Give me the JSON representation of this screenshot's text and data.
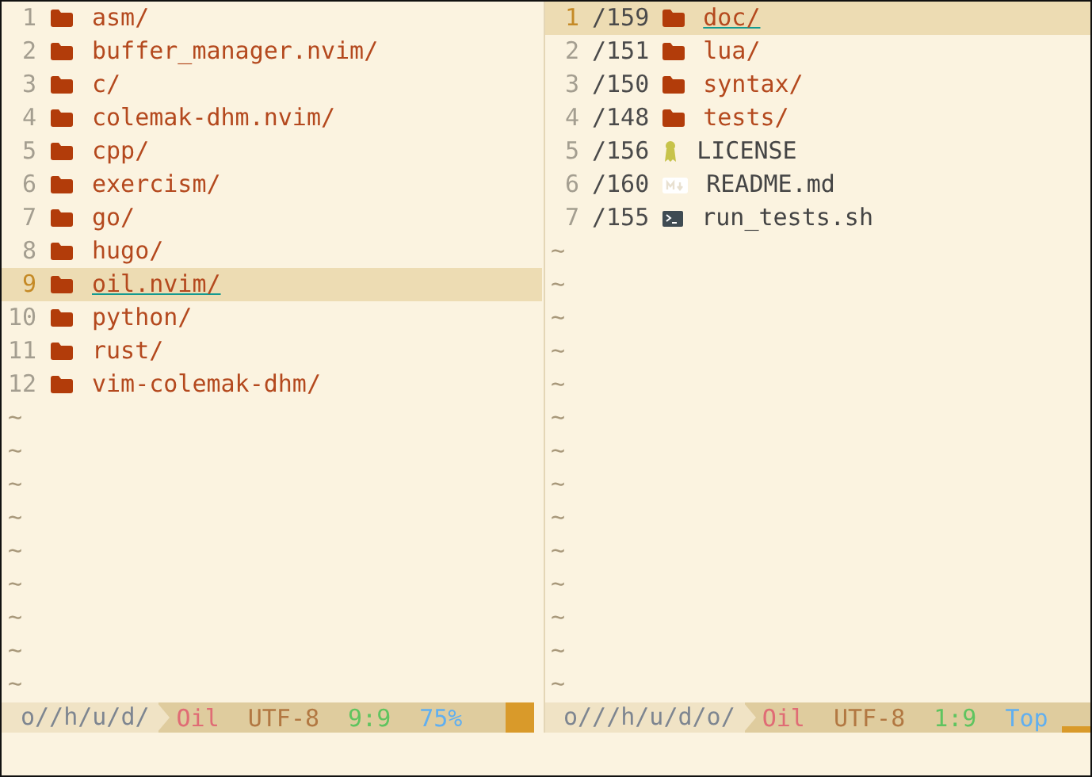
{
  "panes": [
    {
      "active": true,
      "entries": [
        {
          "number": "1",
          "name": "asm/",
          "kind": "dir",
          "selected": false
        },
        {
          "number": "2",
          "name": "buffer_manager.nvim/",
          "kind": "dir",
          "selected": false
        },
        {
          "number": "3",
          "name": "c/",
          "kind": "dir",
          "selected": false
        },
        {
          "number": "4",
          "name": "colemak-dhm.nvim/",
          "kind": "dir",
          "selected": false
        },
        {
          "number": "5",
          "name": "cpp/",
          "kind": "dir",
          "selected": false
        },
        {
          "number": "6",
          "name": "exercism/",
          "kind": "dir",
          "selected": false
        },
        {
          "number": "7",
          "name": "go/",
          "kind": "dir",
          "selected": false
        },
        {
          "number": "8",
          "name": "hugo/",
          "kind": "dir",
          "selected": false
        },
        {
          "number": "9",
          "name": "oil.nvim/",
          "kind": "dir",
          "selected": true
        },
        {
          "number": "10",
          "name": "python/",
          "kind": "dir",
          "selected": false
        },
        {
          "number": "11",
          "name": "rust/",
          "kind": "dir",
          "selected": false
        },
        {
          "number": "12",
          "name": "vim-colemak-dhm/",
          "kind": "dir",
          "selected": false
        }
      ],
      "filler": [
        "~",
        "~",
        "~",
        "~",
        "~",
        "~",
        "~",
        "~",
        "~"
      ],
      "status": {
        "path": "o//h/u/d/",
        "filetype": "Oil",
        "encoding": "UTF-8",
        "position": "9:9",
        "progress": "75%"
      }
    },
    {
      "active": false,
      "entries": [
        {
          "number": "1",
          "id": "/159",
          "name": "doc/",
          "kind": "dir",
          "selected": true
        },
        {
          "number": "2",
          "id": "/151",
          "name": "lua/",
          "kind": "dir",
          "selected": false
        },
        {
          "number": "3",
          "id": "/150",
          "name": "syntax/",
          "kind": "dir",
          "selected": false
        },
        {
          "number": "4",
          "id": "/148",
          "name": "tests/",
          "kind": "dir",
          "selected": false
        },
        {
          "number": "5",
          "id": "/156",
          "name": "LICENSE",
          "kind": "license",
          "selected": false
        },
        {
          "number": "6",
          "id": "/160",
          "name": "README.md",
          "kind": "markdown",
          "selected": false
        },
        {
          "number": "7",
          "id": "/155",
          "name": "run_tests.sh",
          "kind": "script",
          "selected": false
        }
      ],
      "filler": [
        "~",
        "~",
        "~",
        "~",
        "~",
        "~",
        "~",
        "~",
        "~",
        "~",
        "~",
        "~",
        "~",
        "~"
      ],
      "status": {
        "path": "o///h/u/d/o/",
        "filetype": "Oil",
        "encoding": "UTF-8",
        "position": "1:9",
        "progress": "Top"
      }
    }
  ]
}
